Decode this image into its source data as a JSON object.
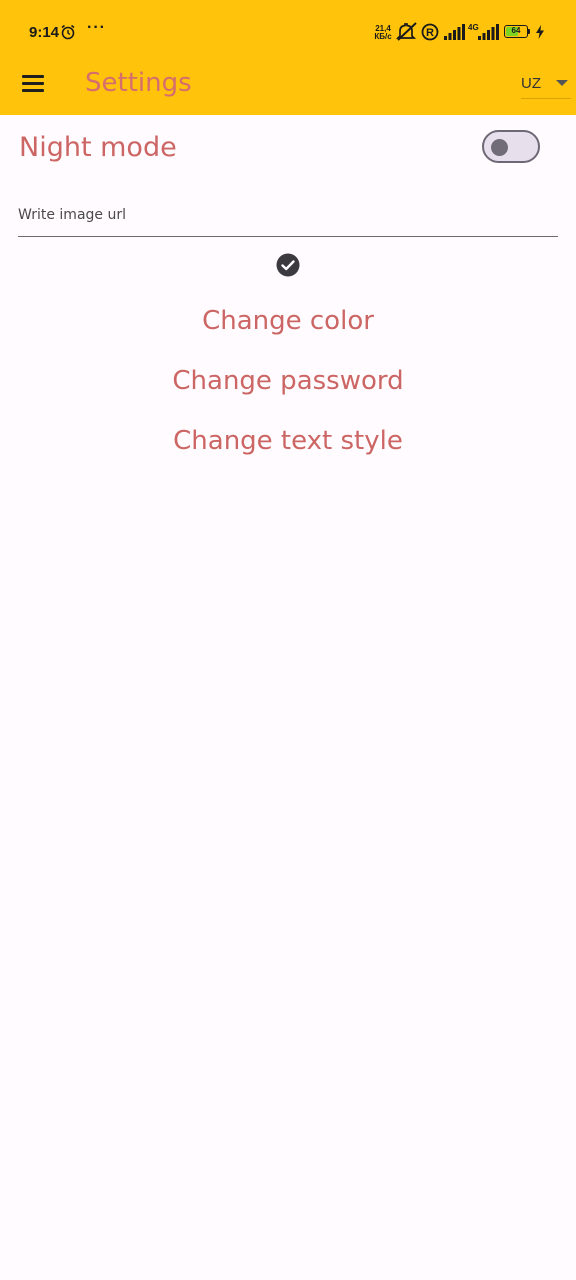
{
  "status_bar": {
    "time": "9:14",
    "more": "···",
    "net_speed_value": "21,4",
    "net_speed_unit": "КБ/с",
    "roaming_badge": "R",
    "network_type": "4G",
    "battery_level": "64",
    "battery_fraction": 0.64,
    "battery_fill_color": "#7ed321",
    "icons": [
      "alarm-icon",
      "more-icon",
      "silent-icon",
      "roaming-icon",
      "signal-icon",
      "signal-4g-icon",
      "battery-icon",
      "charging-icon"
    ]
  },
  "app_bar": {
    "menu_icon": "hamburger-menu-icon",
    "title": "Settings",
    "language_selected": "UZ",
    "background_color": "#ffc30b",
    "title_color": "#d56e6c"
  },
  "settings": {
    "night_mode_label": "Night mode",
    "night_mode_enabled": false,
    "image_url_placeholder": "Write image url",
    "image_url_value": "",
    "confirm_icon": "check-circle-icon",
    "change_color_label": "Change color",
    "change_password_label": "Change password",
    "change_text_style_label": "Change text style",
    "accent_color": "#cc6664"
  }
}
